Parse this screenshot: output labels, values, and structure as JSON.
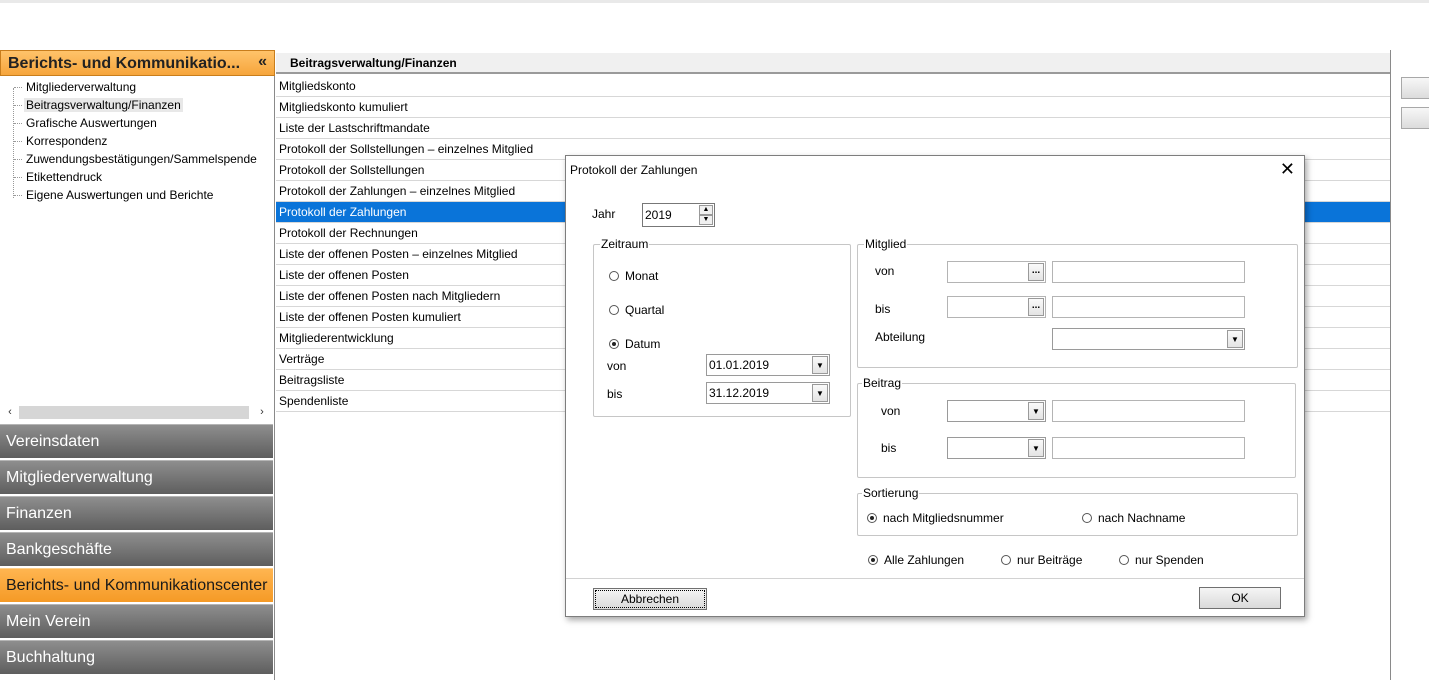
{
  "left_panel": {
    "header_title": "Berichts- und Kommunikatio...",
    "collapse_glyph": "«",
    "tree_items": [
      "Mitgliederverwaltung",
      "Beitragsverwaltung/Finanzen",
      "Grafische Auswertungen",
      "Korrespondenz",
      "Zuwendungsbestätigungen/Sammelspende",
      "Etikettendruck",
      "Eigene Auswertungen und Berichte"
    ],
    "selected_tree_item": 1,
    "scroll_left": "‹",
    "scroll_right": "›",
    "nav_buttons": [
      "Vereinsdaten",
      "Mitgliederverwaltung",
      "Finanzen",
      "Bankgeschäfte",
      "Berichts- und Kommunikationscenter",
      "Mein Verein",
      "Buchhaltung"
    ],
    "active_nav": 4
  },
  "report_panel": {
    "header": "Beitragsverwaltung/Finanzen",
    "rows": [
      "Mitgliedskonto",
      "Mitgliedskonto kumuliert",
      "Liste der Lastschriftmandate",
      "Protokoll der Sollstellungen – einzelnes Mitglied",
      "Protokoll der Sollstellungen",
      "Protokoll der Zahlungen – einzelnes Mitglied",
      "Protokoll der Zahlungen",
      "Protokoll der Rechnungen",
      "Liste der offenen Posten – einzelnes Mitglied",
      "Liste der offenen Posten",
      "Liste der offenen Posten nach Mitgliedern",
      "Liste der offenen Posten kumuliert",
      "Mitgliederentwicklung",
      "Verträge",
      "Beitragsliste",
      "Spendenliste"
    ],
    "selected_row": 6
  },
  "dialog": {
    "title": "Protokoll der Zahlungen",
    "close_glyph": "✕",
    "jahr_label": "Jahr",
    "jahr_value": "2019",
    "zeitraum": {
      "title": "Zeitraum",
      "monat": "Monat",
      "quartal": "Quartal",
      "datum": "Datum",
      "selected": "datum",
      "von_label": "von",
      "von_value": "01.01.2019",
      "bis_label": "bis",
      "bis_value": "31.12.2019"
    },
    "mitglied": {
      "title": "Mitglied",
      "von_label": "von",
      "bis_label": "bis",
      "abteilung_label": "Abteilung",
      "ellipsis": "..."
    },
    "beitrag": {
      "title": "Beitrag",
      "von_label": "von",
      "bis_label": "bis"
    },
    "sortierung": {
      "title": "Sortierung",
      "option1": "nach Mitgliedsnummer",
      "option2": "nach Nachname",
      "selected": "option1"
    },
    "zahlungen": {
      "alle": "Alle Zahlungen",
      "beitraege": "nur Beiträge",
      "spenden": "nur Spenden",
      "selected": "alle"
    },
    "cancel_label": "Abbrechen",
    "ok_label": "OK",
    "dropdown_glyph": "▼",
    "spin_up": "▲",
    "spin_down": "▼"
  },
  "colors": {
    "selection": "#0a74d9",
    "accent_orange": "#f6a53c"
  }
}
